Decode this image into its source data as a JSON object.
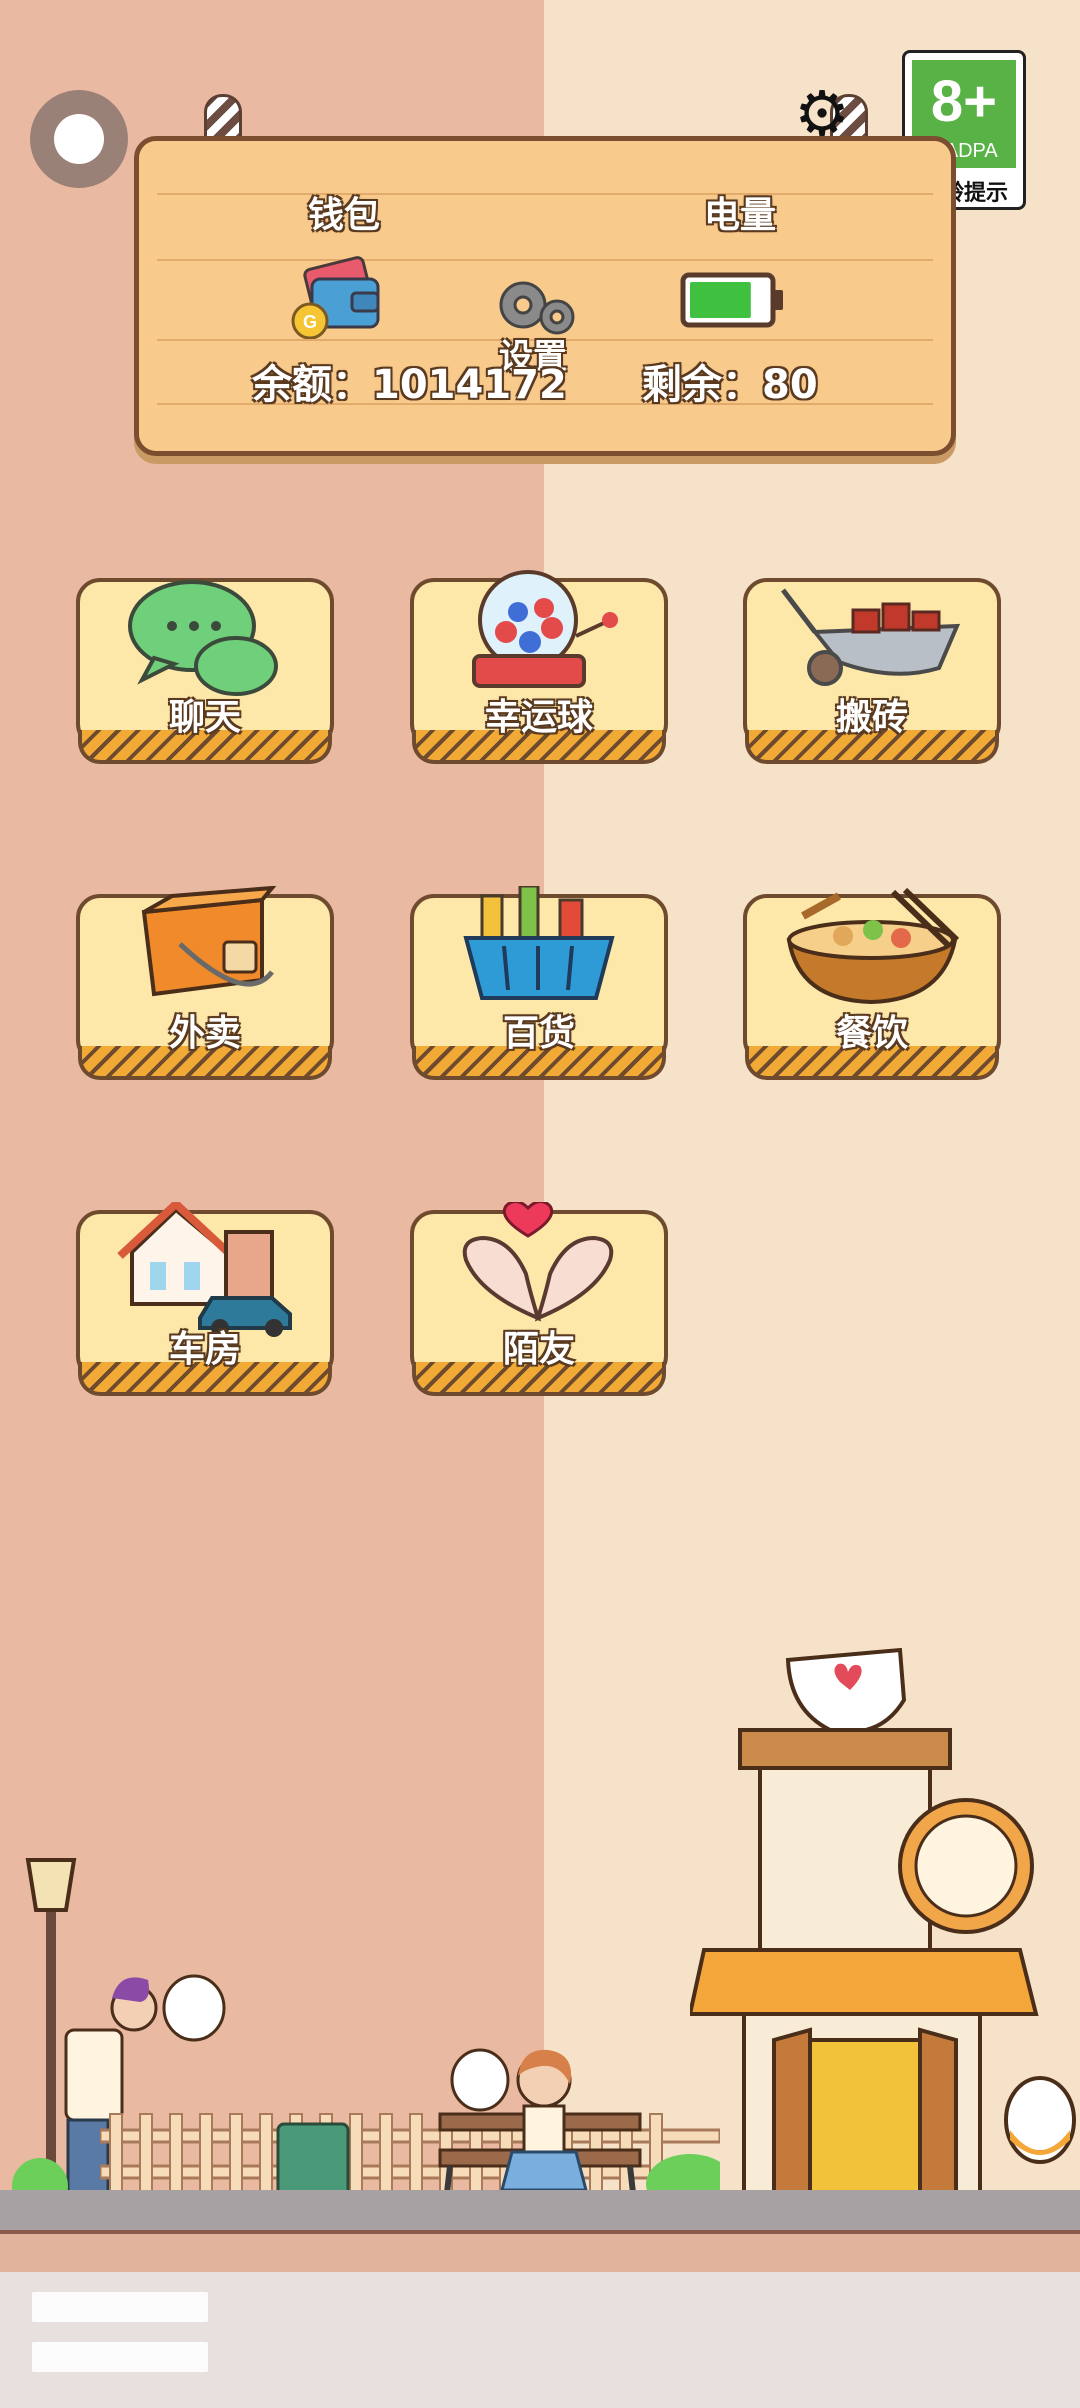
{
  "header": {
    "wallet_title": "钱包",
    "power_title": "电量",
    "balance_label": "余额：1014172",
    "remaining_label": "剩余：80",
    "settings_label": "设置",
    "battery_level": 0.8
  },
  "age_rating": {
    "value": "8+",
    "org": "CADPA",
    "tip": "适龄提示",
    "color": "#58b246"
  },
  "menu": [
    {
      "label": "聊天",
      "icon": "chat-bubbles-icon"
    },
    {
      "label": "幸运球",
      "icon": "lottery-machine-icon"
    },
    {
      "label": "搬砖",
      "icon": "wheelbarrow-icon"
    },
    {
      "label": "外卖",
      "icon": "delivery-box-icon"
    },
    {
      "label": "百货",
      "icon": "shopping-basket-icon"
    },
    {
      "label": "餐饮",
      "icon": "food-bowl-icon"
    },
    {
      "label": "车房",
      "icon": "house-car-icon"
    },
    {
      "label": "陌友",
      "icon": "heart-hands-icon"
    }
  ],
  "colors": {
    "left_background": "#eab9a2",
    "right_background": "#f6e2c8",
    "board": "#f8ca8c",
    "card": "#fde7a9"
  }
}
